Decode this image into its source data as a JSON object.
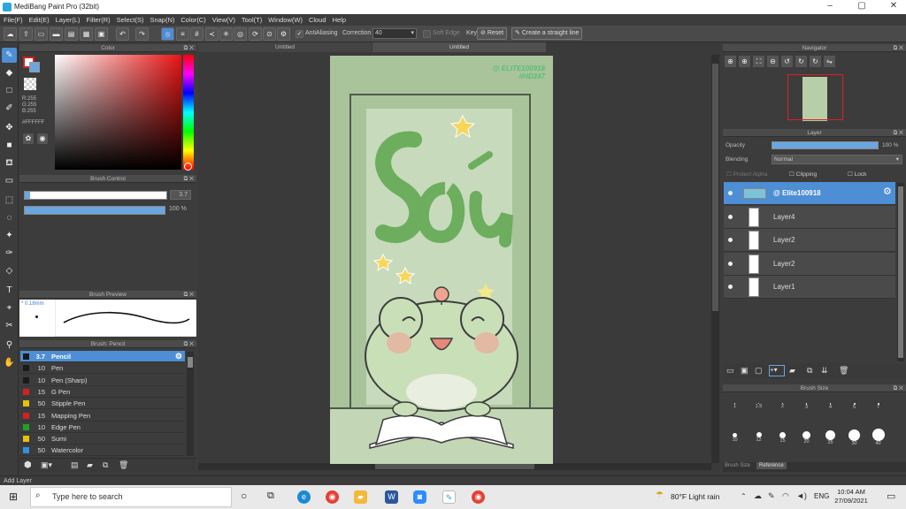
{
  "window": {
    "title": "MediBang Paint Pro (32bit)"
  },
  "menu": [
    "File(F)",
    "Edit(E)",
    "Layer(L)",
    "Filter(R)",
    "Select(S)",
    "Snap(N)",
    "Color(C)",
    "View(V)",
    "Tool(T)",
    "Window(W)",
    "Cloud",
    "Help"
  ],
  "toolbar": {
    "antialiasing_label": "AntiAliasing",
    "correction_label": "Correction",
    "correction_value": "40",
    "soft_edge_label": "Soft Edge",
    "key_label": "Key",
    "reset_label": "Reset",
    "straight_line_label": "Create a straight line"
  },
  "color_panel": {
    "title": "Color",
    "r": "R:255",
    "g": "G:255",
    "b": "B:255",
    "hex": "#FFFFFF"
  },
  "brush_control": {
    "title": "Brush Control",
    "size": "3.7",
    "opacity": "100 %",
    "size_fraction": 0.97,
    "opacity_fraction": 1.0
  },
  "brush_preview": {
    "title": "Brush Preview",
    "size_label": "* 0.18mm"
  },
  "brush_list": {
    "title": "Brush: Pencil",
    "items": [
      {
        "size": "3.7",
        "name": "Pencil",
        "color": "#1a1a1a",
        "selected": true
      },
      {
        "size": "10",
        "name": "Pen",
        "color": "#1a1a1a"
      },
      {
        "size": "10",
        "name": "Pen (Sharp)",
        "color": "#1a1a1a"
      },
      {
        "size": "15",
        "name": "G Pen",
        "color": "#d42020"
      },
      {
        "size": "50",
        "name": "Stipple Pen",
        "color": "#e6c010"
      },
      {
        "size": "15",
        "name": "Mapping Pen",
        "color": "#d42020"
      },
      {
        "size": "10",
        "name": "Edge Pen",
        "color": "#20a020"
      },
      {
        "size": "50",
        "name": "Sumi",
        "color": "#e6c010"
      },
      {
        "size": "50",
        "name": "Watercolor",
        "color": "#3090e0"
      }
    ]
  },
  "canvas": {
    "tabs": [
      "Untitled",
      "Untitled"
    ],
    "art_title": "Sú",
    "watermark_line1": "@ ELITE100918",
    "watermark_line2": "#HD247"
  },
  "navigator": {
    "title": "Navigator"
  },
  "layer_panel": {
    "title": "Layer",
    "opacity_label": "Opacity",
    "opacity_value": "100 %",
    "opacity_fraction": 1.0,
    "blending_label": "Blending",
    "blending_value": "Normal",
    "protect_alpha": "Protect Alpha",
    "clipping": "Clipping",
    "lock": "Lock",
    "layers": [
      {
        "name": "@ Elite100918",
        "selected": true
      },
      {
        "name": "Layer4"
      },
      {
        "name": "Layer2"
      },
      {
        "name": "Layer2"
      },
      {
        "name": "Layer1"
      }
    ]
  },
  "brush_size": {
    "title": "Brush Size",
    "row1": [
      "1",
      "1.5",
      "2",
      "3",
      "4",
      "5",
      "7"
    ],
    "row2": [
      "10",
      "12",
      "15",
      "20",
      "25",
      "30",
      "40"
    ],
    "tab_size": "Brush Size",
    "tab_ref": "Reference"
  },
  "statusbar": {
    "text": "Add Layer"
  },
  "taskbar": {
    "search_placeholder": "Type here to search",
    "weather": "80°F  Light rain",
    "lang": "ENG",
    "time": "10:04 AM",
    "date": "27/09/2021"
  }
}
